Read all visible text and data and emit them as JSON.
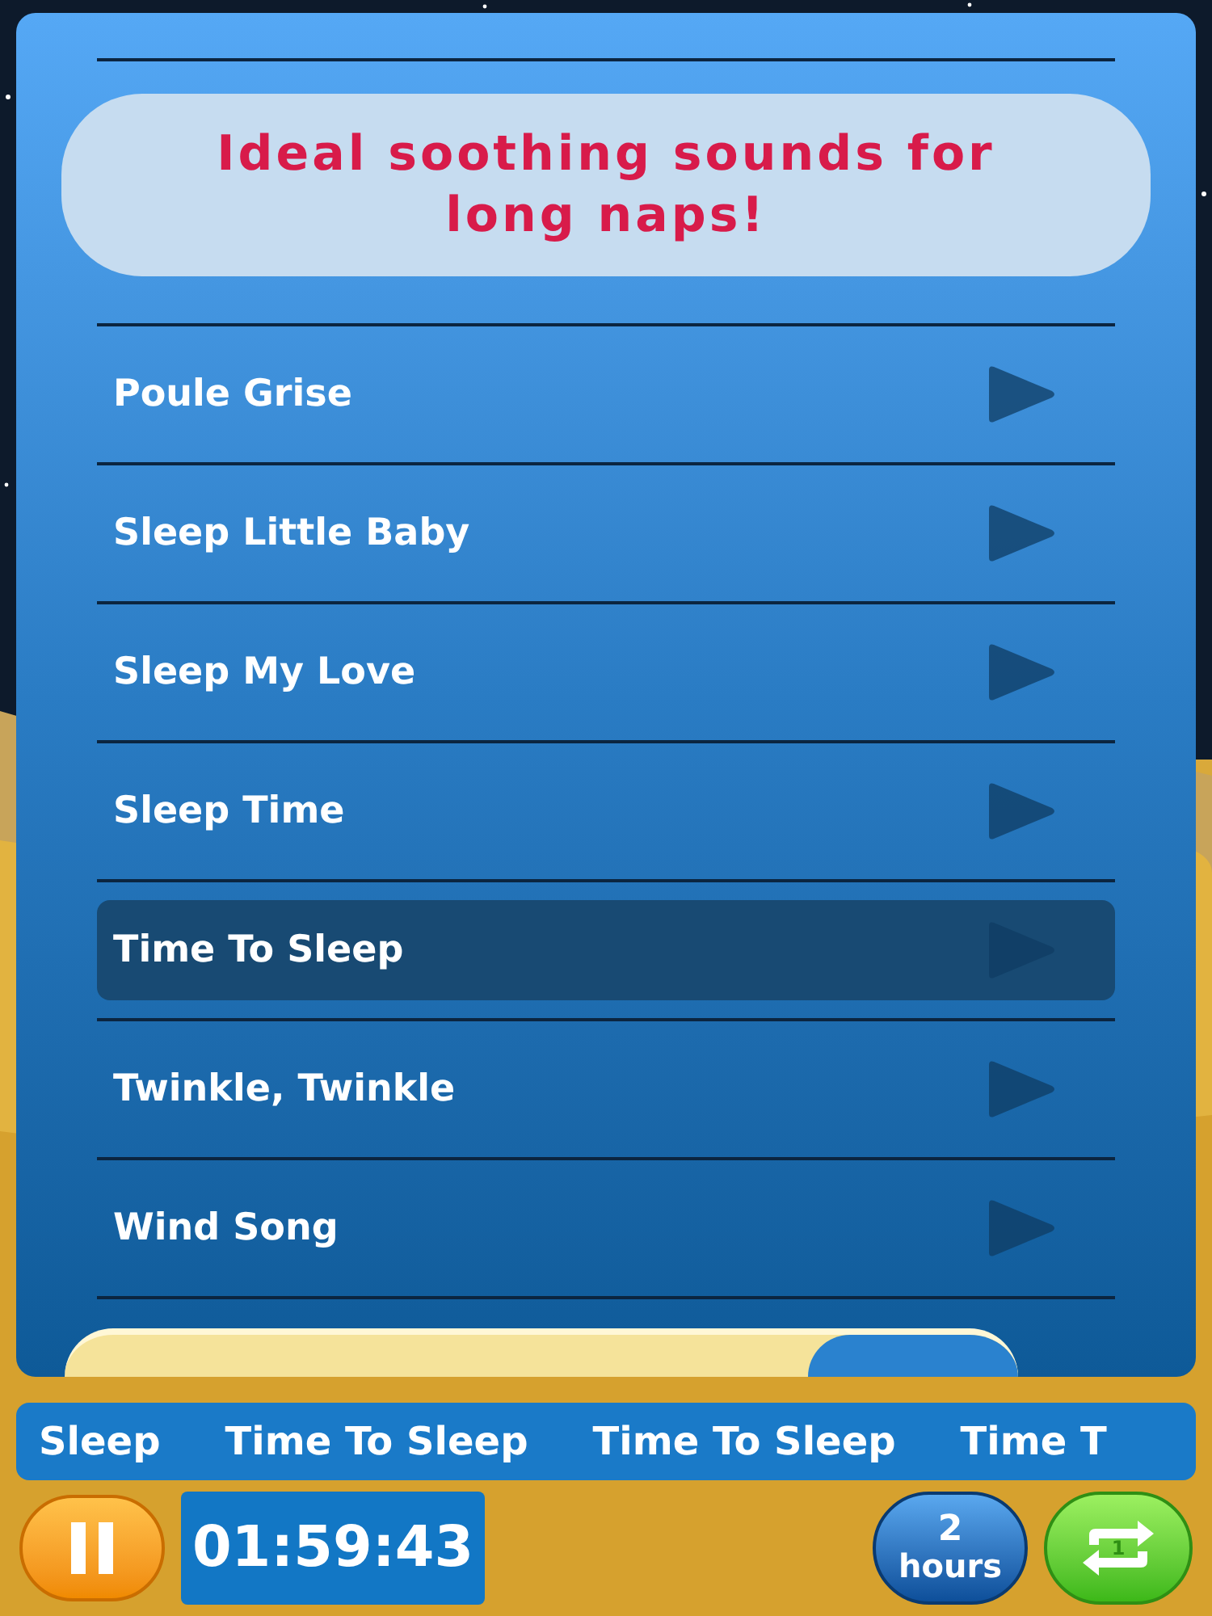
{
  "banner": "Ideal soothing sounds for long naps!",
  "songs": [
    {
      "title": "Poule Grise",
      "selected": false
    },
    {
      "title": "Sleep Little Baby",
      "selected": false
    },
    {
      "title": "Sleep My Love",
      "selected": false
    },
    {
      "title": "Sleep Time",
      "selected": false
    },
    {
      "title": "Time To Sleep",
      "selected": true
    },
    {
      "title": "Twinkle, Twinkle",
      "selected": false
    },
    {
      "title": "Wind Song",
      "selected": false
    }
  ],
  "ticker": [
    "Sleep",
    "Time To Sleep",
    "Time To Sleep",
    "Time T"
  ],
  "controls": {
    "timer": "01:59:43",
    "duration_value": "2",
    "duration_unit": "hours",
    "repeat_badge": "1",
    "playing": true
  }
}
